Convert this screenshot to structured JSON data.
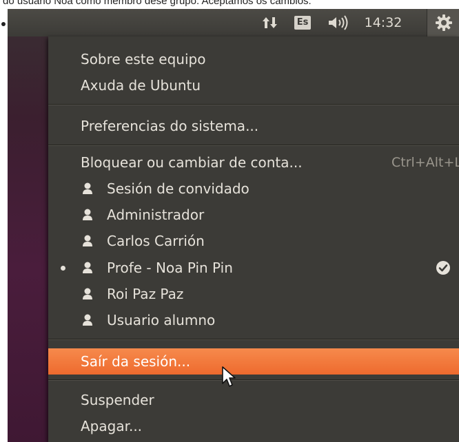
{
  "caption": {
    "text": "do usuario Noa como membro dese grupo. Aceptamos os cambios."
  },
  "topbar": {
    "keyboard_layout": "Es",
    "clock": "14:32",
    "icons": [
      "network-arrows-icon",
      "keyboard-layout-indicator",
      "sound-icon",
      "session-gear-icon"
    ]
  },
  "menu": {
    "about": "Sobre este equipo",
    "help": "Axuda de Ubuntu",
    "preferences": "Preferencias do sistema...",
    "lock": {
      "label": "Bloquear ou cambiar de conta...",
      "shortcut": "Ctrl+Alt+L"
    },
    "users": [
      {
        "name": "Sesión de convidado",
        "active": false
      },
      {
        "name": "Administrador",
        "active": false
      },
      {
        "name": "Carlos Carrión",
        "active": false
      },
      {
        "name": "Profe - Noa Pin Pin",
        "active": true
      },
      {
        "name": "Roi Paz Paz",
        "active": false
      },
      {
        "name": "Usuario alumno",
        "active": false
      }
    ],
    "logout": "Saír da sesión...",
    "suspend": "Suspender",
    "shutdown": "Apagar..."
  },
  "colors": {
    "panel": "#3c3b37",
    "highlight": "#f07a3a",
    "text": "#e6e2da",
    "wallpaper": "#4a1d3c"
  }
}
